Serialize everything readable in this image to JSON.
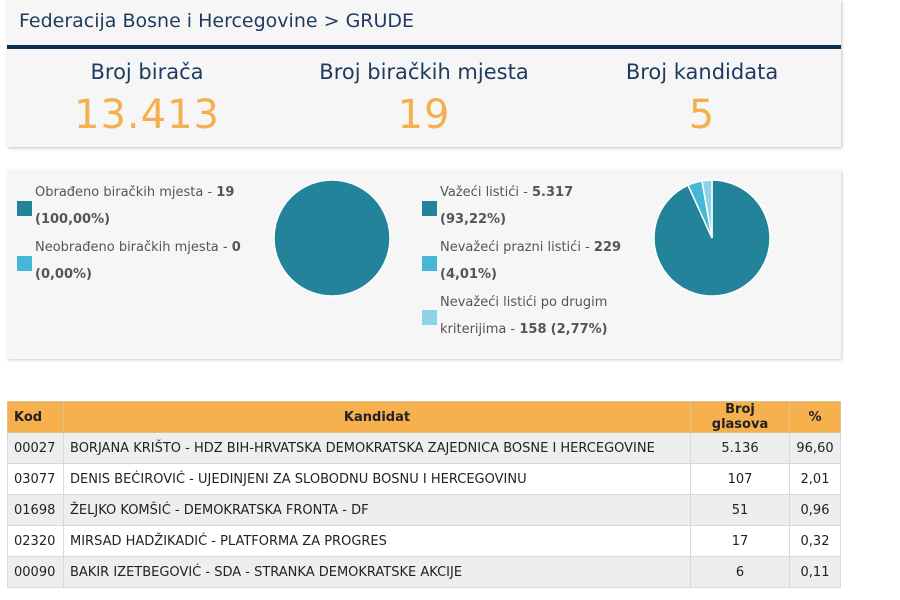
{
  "breadcrumb": "Federacija Bosne i Hercegovine > GRUDE",
  "stats": [
    {
      "label": "Broj birača",
      "value": "13.413"
    },
    {
      "label": "Broj biračkih mjesta",
      "value": "19"
    },
    {
      "label": "Broj kandidata",
      "value": "5"
    }
  ],
  "colors": {
    "dark_teal": "#23839b",
    "light_blue": "#46b7d6",
    "pale_blue": "#8fd3ea",
    "orange": "#f4b04e",
    "navy": "#0e2a4d"
  },
  "chart_data": [
    {
      "type": "pie",
      "slices": [
        {
          "label": "Obrađeno biračkih mjesta",
          "count": "19",
          "percent_text": "(100,00%)",
          "value": 100.0,
          "color": "#23839b"
        },
        {
          "label": "Neobrađeno biračkih mjesta",
          "count": "0",
          "percent_text": "(0,00%)",
          "value": 0.0,
          "color": "#46b7d6"
        }
      ]
    },
    {
      "type": "pie",
      "slices": [
        {
          "label": "Važeći listići",
          "count": "5.317",
          "percent_text": "(93,22%)",
          "value": 93.22,
          "color": "#23839b"
        },
        {
          "label": "Nevažeći prazni listići",
          "count": "229",
          "percent_text": "(4,01%)",
          "value": 4.01,
          "color": "#46b7d6"
        },
        {
          "label": "Nevažeći listići po drugim kriterijima",
          "label_line1": "Nevažeći listići po drugim",
          "label_line2": "kriterijima",
          "count": "158",
          "percent_text": "(2,77%)",
          "value": 2.77,
          "color": "#8fd3ea"
        }
      ]
    }
  ],
  "table": {
    "headers": [
      "Kod",
      "Kandidat",
      "Broj glasova",
      "%"
    ],
    "rows": [
      {
        "kod": "00027",
        "kandidat": "BORJANA KRIŠTO - HDZ BIH-HRVATSKA DEMOKRATSKA ZAJEDNICA BOSNE I HERCEGOVINE",
        "glasova": "5.136",
        "pct": "96,60"
      },
      {
        "kod": "03077",
        "kandidat": "DENIS BEĆIROVIĆ - UJEDINJENI ZA SLOBODNU BOSNU I HERCEGOVINU",
        "glasova": "107",
        "pct": "2,01"
      },
      {
        "kod": "01698",
        "kandidat": "ŽELJKO KOMŠIĆ - DEMOKRATSKA FRONTA - DF",
        "glasova": "51",
        "pct": "0,96"
      },
      {
        "kod": "02320",
        "kandidat": "MIRSAD HADŽIKADIĆ - PLATFORMA ZA PROGRES",
        "glasova": "17",
        "pct": "0,32"
      },
      {
        "kod": "00090",
        "kandidat": "BAKIR IZETBEGOVIĆ - SDA - STRANKA DEMOKRATSKE AKCIJE",
        "glasova": "6",
        "pct": "0,11"
      }
    ]
  }
}
